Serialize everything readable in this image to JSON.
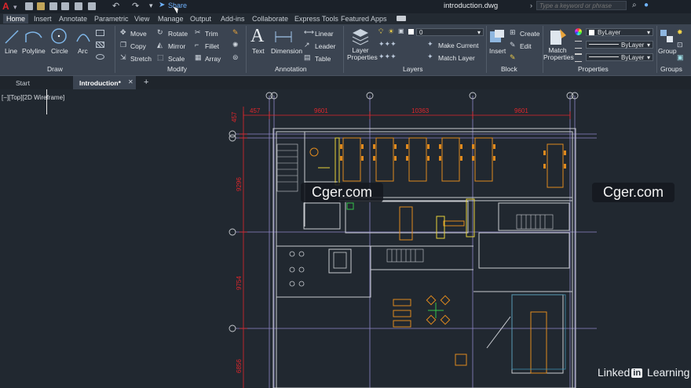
{
  "title_bar": {
    "app_letter": "A",
    "share_label": "Share",
    "document_title": "introduction.dwg",
    "search_placeholder": "Type a keyword or phrase"
  },
  "ribbon_tabs": [
    "Home",
    "Insert",
    "Annotate",
    "Parametric",
    "View",
    "Manage",
    "Output",
    "Add-ins",
    "Collaborate",
    "Express Tools",
    "Featured Apps"
  ],
  "draw": {
    "title": "Draw",
    "line": "Line",
    "polyline": "Polyline",
    "circle": "Circle",
    "arc": "Arc"
  },
  "modify": {
    "title": "Modify",
    "move": "Move",
    "rotate": "Rotate",
    "trim": "Trim",
    "copy": "Copy",
    "mirror": "Mirror",
    "fillet": "Fillet",
    "stretch": "Stretch",
    "scale": "Scale",
    "array": "Array"
  },
  "annotation": {
    "title": "Annotation",
    "text": "Text",
    "dimension": "Dimension",
    "linear": "Linear",
    "leader": "Leader",
    "table": "Table"
  },
  "layers": {
    "title": "Layers",
    "layer_properties": "Layer Properties",
    "current_layer": "0",
    "make_current": "Make Current",
    "match_layer": "Match Layer"
  },
  "block": {
    "title": "Block",
    "insert": "Insert",
    "create": "Create",
    "edit": "Edit"
  },
  "properties": {
    "title": "Properties",
    "match_properties": "Match Properties",
    "color": "ByLayer",
    "linetype": "ByLayer",
    "lineweight": "ByLayer"
  },
  "groups": {
    "title": "Groups",
    "group": "Group"
  },
  "doc_tabs": {
    "start": "Start",
    "current": "Introduction*",
    "add": "+"
  },
  "viewport_label": "[−][Top][2D Wireframe]",
  "dimensions": {
    "top": [
      "457",
      "9601",
      "10363",
      "9601"
    ],
    "left": [
      "457",
      "9296",
      "9754",
      "6856"
    ]
  },
  "watermarks": [
    "Cger.com",
    "Cger.com"
  ],
  "brand": {
    "name": "Linked",
    "in": "in",
    "suffix": "Learning"
  },
  "colors": {
    "dim_red": "#e0262b",
    "furniture_orange": "#e08a1e",
    "wall_gray": "#c9ccd1",
    "grid_purple": "#8f86c8",
    "accent_yellow": "#e8d23a"
  }
}
